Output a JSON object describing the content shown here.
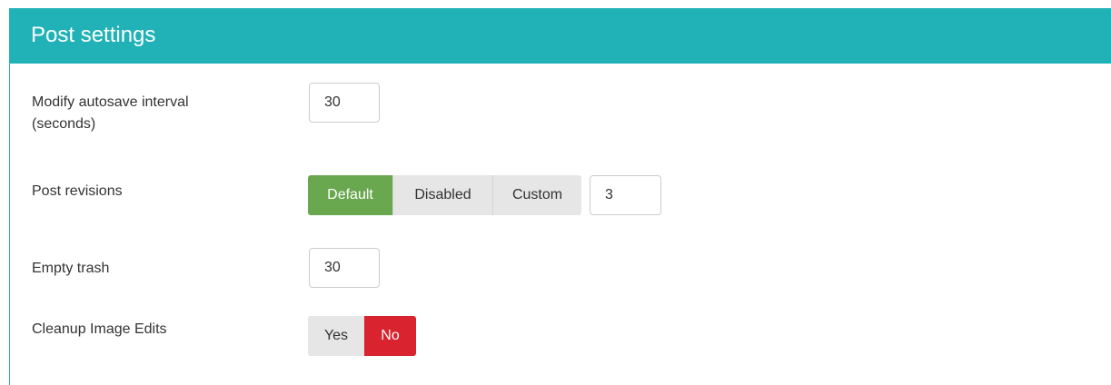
{
  "panel": {
    "title": "Post settings",
    "header_color": "#20b2b6"
  },
  "autosave": {
    "label_line1": "Modify autosave interval",
    "label_line2": "(seconds)",
    "value": "30"
  },
  "revisions": {
    "label": "Post revisions",
    "options": [
      "Default",
      "Disabled",
      "Custom"
    ],
    "selected": "Default",
    "selected_color": "#6aa84f",
    "custom_value": "3"
  },
  "trash": {
    "label": "Empty trash",
    "value": "30"
  },
  "image_edits": {
    "label": "Cleanup Image Edits",
    "options": [
      "Yes",
      "No"
    ],
    "selected": "No",
    "selected_color": "#d9232e"
  }
}
